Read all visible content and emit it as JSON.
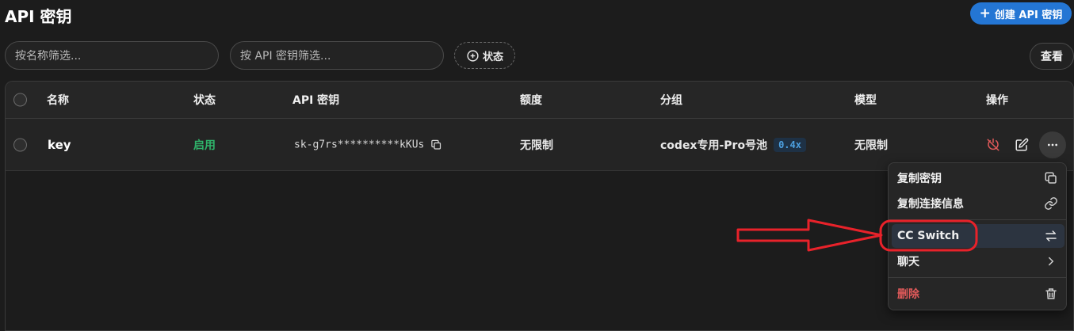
{
  "page": {
    "title": "API 密钥",
    "create_button_label": "创建 API 密钥"
  },
  "filters": {
    "name_placeholder": "按名称筛选...",
    "key_placeholder": "按 API 密钥筛选...",
    "status_label": "状态",
    "view_label": "查看"
  },
  "table": {
    "headers": {
      "name": "名称",
      "status": "状态",
      "key": "API 密钥",
      "quota": "额度",
      "group": "分组",
      "model": "模型",
      "actions": "操作"
    },
    "rows": [
      {
        "name": "key",
        "status": "启用",
        "key": "sk-g7rs**********kKUs",
        "quota": "无限制",
        "group": "codex专用-Pro号池",
        "group_ratio": "0.4x",
        "model": "无限制"
      }
    ]
  },
  "menu": {
    "items": [
      {
        "label": "复制密钥",
        "icon": "copy-icon"
      },
      {
        "label": "复制连接信息",
        "icon": "link-icon"
      },
      {
        "label": "CC Switch",
        "icon": "swap-icon"
      },
      {
        "label": "聊天",
        "icon": "chevron-right-icon"
      },
      {
        "label": "删除",
        "icon": "trash-icon"
      }
    ]
  },
  "colors": {
    "accent": "#2476d4",
    "enabled": "#2fb36a",
    "danger": "#e05a5a",
    "annotation": "#e8222a"
  }
}
